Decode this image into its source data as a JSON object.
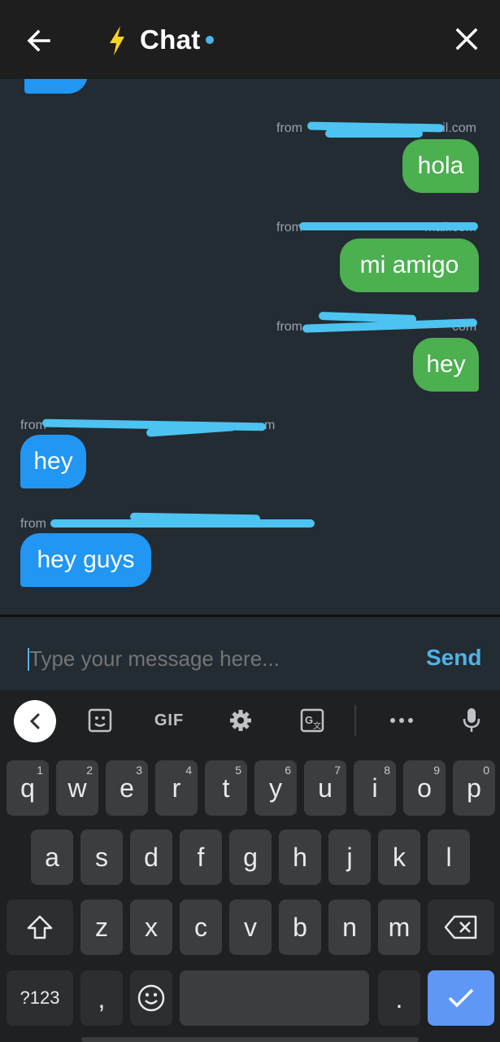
{
  "header": {
    "title": "Chat",
    "accent_color": "#4fb3ea",
    "back_icon": "arrow-left-icon",
    "lightning_icon": "lightning-bolt-icon",
    "close_icon": "close-icon"
  },
  "messages": [
    {
      "from": "from",
      "from_suffix": "mail.com",
      "text": "hola",
      "direction": "outgoing"
    },
    {
      "from": "from",
      "from_suffix": "mail.com",
      "text": "mi amigo",
      "direction": "outgoing"
    },
    {
      "from": "from",
      "from_suffix": "com",
      "text": "hey",
      "direction": "outgoing"
    },
    {
      "from": "from",
      "from_suffix": "m",
      "text": "hey",
      "direction": "incoming"
    },
    {
      "from": "from",
      "from_suffix": "",
      "text": "hey guys",
      "direction": "incoming"
    }
  ],
  "composer": {
    "placeholder": "Type your message here...",
    "send_label": "Send"
  },
  "keyboard": {
    "toolbar": {
      "gif_label": "GIF"
    },
    "row1": [
      {
        "key": "q",
        "hint": "1"
      },
      {
        "key": "w",
        "hint": "2"
      },
      {
        "key": "e",
        "hint": "3"
      },
      {
        "key": "r",
        "hint": "4"
      },
      {
        "key": "t",
        "hint": "5"
      },
      {
        "key": "y",
        "hint": "6"
      },
      {
        "key": "u",
        "hint": "7"
      },
      {
        "key": "i",
        "hint": "8"
      },
      {
        "key": "o",
        "hint": "9"
      },
      {
        "key": "p",
        "hint": "0"
      }
    ],
    "row2": [
      "a",
      "s",
      "d",
      "f",
      "g",
      "h",
      "j",
      "k",
      "l"
    ],
    "row3": [
      "z",
      "x",
      "c",
      "v",
      "b",
      "n",
      "m"
    ],
    "symbols_label": "?123",
    "comma_label": ",",
    "period_label": "."
  }
}
